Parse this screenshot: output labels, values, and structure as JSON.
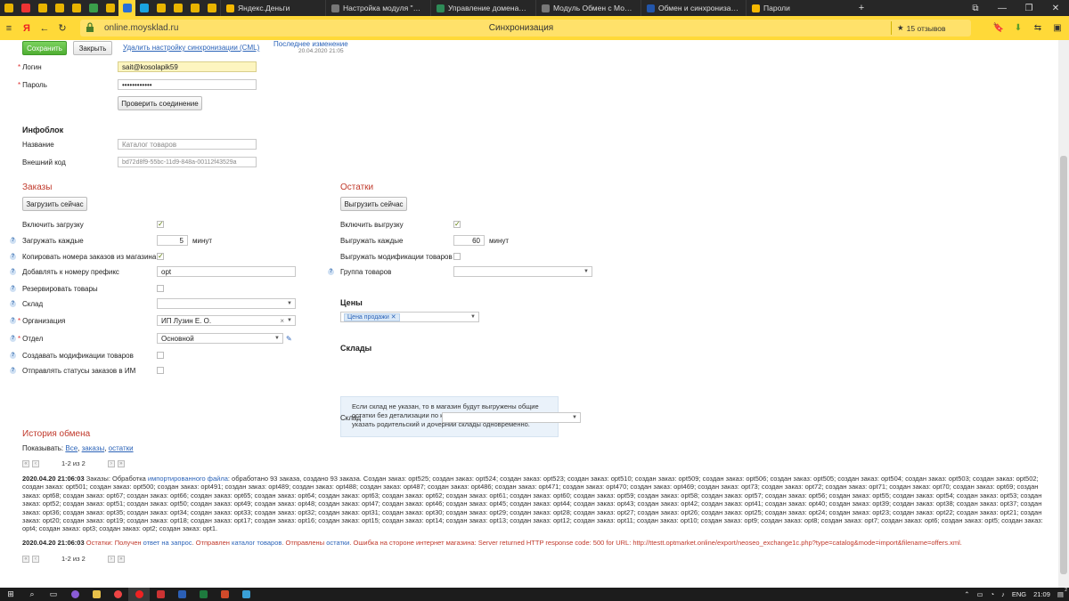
{
  "browser": {
    "tabs": [
      {
        "title": "Яндекс.Деньги",
        "color": "#f5b800"
      },
      {
        "title": "Настройка модуля \"NeoS",
        "color": "#555"
      },
      {
        "title": "Управление доменами | Г",
        "color": "#2e8b57"
      },
      {
        "title": "Модуль Обмен с Мой Ск",
        "color": "#555"
      },
      {
        "title": "Обмен и синхронизация",
        "color": "#2255aa"
      },
      {
        "title": "Пароли",
        "color": "#f5b800"
      }
    ],
    "url": "online.moysklad.ru",
    "page_title": "Синхронизация",
    "reviews": "15 отзывов"
  },
  "toolbar": {
    "save": "Сохранить",
    "close": "Закрыть",
    "delete": "Удалить настройку синхронизации (CML)",
    "last_change_label": "Последнее изменение",
    "last_change_date": "20.04.2020 21:05"
  },
  "auth": {
    "login_label": "Логин",
    "login_value": "sait@kosolapik59",
    "password_label": "Пароль",
    "password_value": "••••••••••••",
    "check_button": "Проверить соединение"
  },
  "infoblock": {
    "heading": "Инфоблок",
    "name_label": "Название",
    "name_value": "Каталог товаров",
    "ext_code_label": "Внешний код",
    "ext_code_value": "bd72d8f9-55bc-11d9-848a-00112f43529a"
  },
  "orders": {
    "heading": "Заказы",
    "load_now": "Загрузить сейчас",
    "enable_label": "Включить загрузку",
    "every_label": "Загружать каждые",
    "every_value": "5",
    "minutes": "минут",
    "copy_numbers_label": "Копировать номера заказов из магазина",
    "prefix_label": "Добавлять к номеру префикс",
    "prefix_value": "opt",
    "reserve_label": "Резервировать товары",
    "warehouse_label": "Склад",
    "org_label": "Организация",
    "org_value": "ИП Лузин Е. О.",
    "dept_label": "Отдел",
    "dept_value": "Основной",
    "create_mods_label": "Создавать модификации товаров",
    "send_status_label": "Отправлять статусы заказов в ИМ"
  },
  "stock": {
    "heading": "Остатки",
    "unload_now": "Выгрузить сейчас",
    "enable_label": "Включить выгрузку",
    "every_label": "Выгружать каждые",
    "every_value": "60",
    "minutes": "минут",
    "mods_label": "Выгружать модификации товаров",
    "group_label": "Группа товаров"
  },
  "prices": {
    "heading": "Цены",
    "tag": "Цена продажи"
  },
  "warehouses": {
    "heading": "Склады",
    "note": "Если склад не указан, то в магазин будут выгружены общие остатки без детализации по конкретным складам. Нельзя указать родительский и дочерний склады одновременно.",
    "label": "Склад"
  },
  "history": {
    "heading": "История обмена",
    "show_label": "Показывать:",
    "filter_all": "Все",
    "filter_orders": "заказы",
    "filter_stock": "остатки",
    "pager": "1-2 из 2",
    "entry1_time": "2020.04.20 21:06:03",
    "entry1_prefix": "Заказы: Обработка",
    "entry1_link": "импортированного файла",
    "entry1_text": ": обработано 93 заказа, создано 93 заказа. Создан заказ: opt525; создан заказ: opt524; создан заказ: opt523; создан заказ: opt510; создан заказ: opt509; создан заказ: opt506; создан заказ: opt505; создан заказ: opt504; создан заказ: opt503; создан заказ: opt502; создан заказ: opt501; создан заказ: opt500; создан заказ: opt491; создан заказ: opt489; создан заказ: opt488; создан заказ: opt487; создан заказ: opt486; создан заказ: opt471; создан заказ: opt470; создан заказ: opt469; создан заказ: opt73; создан заказ: opt72; создан заказ: opt71; создан заказ: opt70; создан заказ: opt69; создан заказ: opt68; создан заказ: opt67; создан заказ: opt66; создан заказ: opt65; создан заказ: opt64; создан заказ: opt63; создан заказ: opt62; создан заказ: opt61; создан заказ: opt60; создан заказ: opt59; создан заказ: opt58; создан заказ: opt57; создан заказ: opt56; создан заказ: opt55; создан заказ: opt54; создан заказ: opt53; создан заказ: opt52; создан заказ: opt51; создан заказ: opt50; создан заказ: opt49; создан заказ: opt48; создан заказ: opt47; создан заказ: opt46; создан заказ: opt45; создан заказ: opt44; создан заказ: opt43; создан заказ: opt42; создан заказ: opt41; создан заказ: opt40; создан заказ: opt39; создан заказ: opt38; создан заказ: opt37; создан заказ: opt36; создан заказ: opt35; создан заказ: opt34; создан заказ: opt33; создан заказ: opt32; создан заказ: opt31; создан заказ: opt30; создан заказ: opt29; создан заказ: opt28; создан заказ: opt27; создан заказ: opt26; создан заказ: opt25; создан заказ: opt24; создан заказ: opt23; создан заказ: opt22; создан заказ: opt21; создан заказ: opt20; создан заказ: opt19; создан заказ: opt18; создан заказ: opt17; создан заказ: opt16; создан заказ: opt15; создан заказ: opt14; создан заказ: opt13; создан заказ: opt12; создан заказ: opt11; создан заказ: opt10; создан заказ: opt9; создан заказ: opt8; создан заказ: opt7; создан заказ: opt6; создан заказ: opt5; создан заказ: opt4; создан заказ: opt3; создан заказ: opt2; создан заказ: opt1.",
    "entry2_time": "2020.04.20 21:06:03",
    "entry2_a": "Остатки: Получен",
    "entry2_link1": "ответ на запрос",
    "entry2_b": ". Отправлен",
    "entry2_link2": "каталог товаров",
    "entry2_c": ". Отправлены",
    "entry2_link3": "остатки",
    "entry2_d": ". Ошибка на стороне интернет магазина: Server returned HTTP response code: 500 for URL: http://ttestt.optmarket.online/export/neoseo_exchange1c.php?type=catalog&mode=import&filename=offers.xml."
  },
  "taskbar": {
    "lang": "ENG",
    "time": "21:09",
    "notif_count": "2"
  }
}
